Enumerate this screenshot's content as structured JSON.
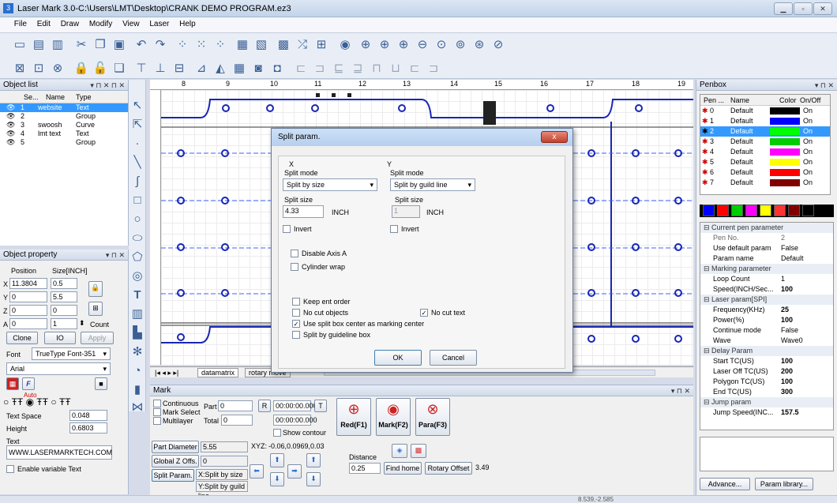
{
  "window": {
    "title": "Laser Mark 3.0-C:\\Users\\LMT\\Desktop\\CRANK DEMO PROGRAM.ez3",
    "icon": "3"
  },
  "menu": [
    "File",
    "Edit",
    "Draw",
    "Modify",
    "View",
    "Laser",
    "Help"
  ],
  "object_list": {
    "title": "Object list",
    "columns": [
      "Se...",
      "Name",
      "Type"
    ],
    "rows": [
      {
        "id": "1",
        "name": "website",
        "type": "Text"
      },
      {
        "id": "2",
        "name": "",
        "type": "Group"
      },
      {
        "id": "3",
        "name": "swoosh",
        "type": "Curve"
      },
      {
        "id": "4",
        "name": "lmt text",
        "type": "Text"
      },
      {
        "id": "5",
        "name": "",
        "type": "Group"
      }
    ]
  },
  "object_property": {
    "title": "Object property",
    "position_label": "Position",
    "size_label": "Size[INCH]",
    "x_label": "X",
    "x_pos": "11.3804",
    "x_size": "0.5",
    "y_label": "Y",
    "y_pos": "0",
    "y_size": "5.5",
    "z_label": "Z",
    "z_pos": "0",
    "z_size": "0",
    "a_label": "A",
    "a_pos": "0",
    "a_count": "1",
    "count_label": "Count",
    "clone": "Clone",
    "io": "IO",
    "apply": "Apply",
    "font_label": "Font",
    "font_type": "TrueType Font-351",
    "font_name": "Arial",
    "auto_label": "Auto",
    "text_space_label": "Text Space",
    "text_space": "0.048",
    "height_label": "Height",
    "height": "0.6803",
    "text_label": "Text",
    "text": "WWW.LASERMARKTECH.COM",
    "enable_variable": "Enable variable Text"
  },
  "ruler": [
    "8",
    "9",
    "10",
    "11",
    "12",
    "13",
    "14",
    "15",
    "16",
    "17",
    "18",
    "19"
  ],
  "tabs": [
    "datamatrix",
    "rotary move"
  ],
  "dialog": {
    "title": "Split param.",
    "close": "x",
    "x_section": "X",
    "y_section": "Y",
    "x_mode_label": "Split mode",
    "x_mode": "Split by size",
    "y_mode_label": "Split mode",
    "y_mode": "Split by guild line",
    "x_size_label": "Split size",
    "x_size": "4.33",
    "x_unit": "INCH",
    "y_size_label": "Split size",
    "y_size": "1",
    "y_unit": "INCH",
    "x_invert": "Invert",
    "y_invert": "Invert",
    "disable_axis_a": "Disable Axis A",
    "cylinder_wrap": "Cylinder wrap",
    "keep_order": "Keep ent order",
    "no_cut_objects": "No cut objects",
    "no_cut_text": "No cut text",
    "use_split_center": "Use split box center as marking center",
    "split_guideline": "Split by guideline box",
    "ok": "OK",
    "cancel": "Cancel"
  },
  "mark": {
    "title": "Mark",
    "continuous": "Continuous",
    "mark_select": "Mark Select",
    "multilayer": "Multilayer",
    "part_label": "Part",
    "part": "0",
    "total_label": "Total",
    "total": "0",
    "r": "R",
    "t": "T",
    "time1": "00:00:00.000",
    "time2": "00:00:00.000",
    "show_contour": "Show contour",
    "red": "Red(F1)",
    "markf2": "Mark(F2)",
    "para": "Para(F3)",
    "part_diameter": "Part Diameter",
    "part_diameter_val": "5.55",
    "global_z": "Global Z Offs.",
    "global_z_val": "0",
    "split_param": "Split Param.",
    "x_split": "X:Split by size",
    "y_split": "Y:Split by guild line",
    "xyz_label": "XYZ:",
    "xyz": "-0.06,0.0969,0.03",
    "distance_label": "Distance",
    "distance": "0.25",
    "find_home": "Find home",
    "rotary_offset": "Rotary Offset",
    "rotary_offset_val": "3.49"
  },
  "penbox": {
    "title": "Penbox",
    "columns": [
      "Pen ...",
      "Name",
      "Color",
      "On/Off"
    ],
    "rows": [
      {
        "no": "0",
        "name": "Default",
        "color": "#000000",
        "state": "On"
      },
      {
        "no": "1",
        "name": "Default",
        "color": "#0000ff",
        "state": "On"
      },
      {
        "no": "2",
        "name": "Default",
        "color": "#00ff00",
        "state": "On"
      },
      {
        "no": "3",
        "name": "Default",
        "color": "#00cc00",
        "state": "On"
      },
      {
        "no": "4",
        "name": "Default",
        "color": "#ff00ff",
        "state": "On"
      },
      {
        "no": "5",
        "name": "Default",
        "color": "#ffff00",
        "state": "On"
      },
      {
        "no": "6",
        "name": "Default",
        "color": "#ff0000",
        "state": "On"
      },
      {
        "no": "7",
        "name": "Default",
        "color": "#800000",
        "state": "On"
      }
    ],
    "swatches": [
      "#000000",
      "#0000ff",
      "#ff0000",
      "#00cc00",
      "#ff00ff",
      "#ffff00",
      "#ff3333",
      "#800000"
    ],
    "groups": [
      {
        "title": "Current pen parameter",
        "items": [
          [
            "Pen No.",
            "2"
          ],
          [
            "Use default param",
            "False"
          ],
          [
            "Param name",
            "Default"
          ]
        ]
      },
      {
        "title": "Marking parameter",
        "items": [
          [
            "Loop Count",
            "1"
          ],
          [
            "Speed(INCH/Sec...",
            "100"
          ]
        ]
      },
      {
        "title": "Laser param[SPI]",
        "items": [
          [
            "Frequency(KHz)",
            "25"
          ],
          [
            "Power(%)",
            "100"
          ],
          [
            "Continue mode",
            "False"
          ],
          [
            "Wave",
            "Wave0"
          ]
        ]
      },
      {
        "title": "Delay Param",
        "items": [
          [
            "Start TC(US)",
            "100"
          ],
          [
            "Laser Off TC(US)",
            "200"
          ],
          [
            "Polygon TC(US)",
            "100"
          ],
          [
            "End TC(US)",
            "300"
          ]
        ]
      },
      {
        "title": "Jump param",
        "items": [
          [
            "Jump Speed(INC...",
            "157.5"
          ]
        ]
      }
    ],
    "advance": "Advance...",
    "param_library": "Param library..."
  },
  "status": {
    "coords": "8.539,-2.585"
  }
}
